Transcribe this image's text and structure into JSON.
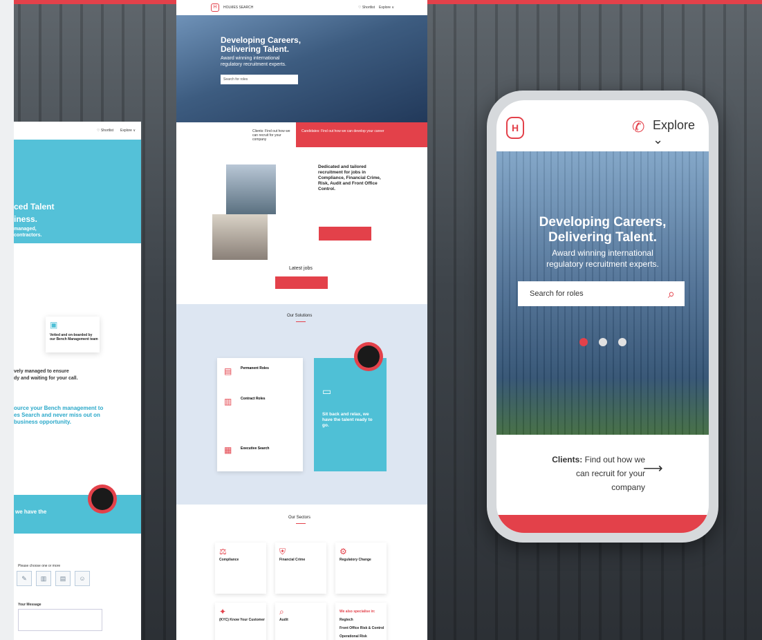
{
  "colors": {
    "accent": "#e3414a",
    "teal": "#4fc0d6",
    "light_blue": "#dde6f2"
  },
  "left_page": {
    "header": {
      "shortlist": "♡ Shortlist",
      "explore": "Explore ∨"
    },
    "hero_line1": "ced Talent",
    "hero_line2": "iness.",
    "hero_line3": "managed,",
    "hero_line4": "contractors.",
    "card_text": "Vetted and on-boarded by our Bench Management team",
    "bench_line1": "vely managed to ensure",
    "bench_line2": "dy and waiting for your call.",
    "blue_line1": "ource your Bench management to",
    "blue_line2": "es Search and never miss out on",
    "blue_line3": "business opportunity.",
    "teal_text": "we have the",
    "choose_label": "Please choose one or more",
    "message_label": "Your Message"
  },
  "center_page": {
    "nav_brand": "HOLMES SEARCH",
    "nav_shortlist": "♡ Shortlist",
    "nav_explore": "Explore ∨",
    "hero_title_1": "Developing Careers,",
    "hero_title_2": "Delivering Talent.",
    "hero_sub_1": "Award winning international",
    "hero_sub_2": "regulatory recruitment experts.",
    "search_placeholder": "Search for roles",
    "cta_clients": "Clients: Find out how we can recruit for your company",
    "cta_candidates": "Candidates: Find out how we can develop your career",
    "intro_1": "Dedicated and tailored",
    "intro_2": "recruitment for jobs in",
    "intro_3": "Compliance, Financial Crime,",
    "intro_4": "Risk, Audit and Front Office",
    "intro_5": "Control.",
    "latest_jobs": "Latest jobs",
    "solutions_title": "Our Solutions",
    "sol_permanent": "Permanent Roles",
    "sol_contract": "Contract Roles",
    "sol_exec": "Executive Search",
    "teal_1": "Sit back and relax, we",
    "teal_2": "have the talent ready to",
    "teal_3": "go.",
    "sectors_title": "Our Sectors",
    "sec_compliance": "Compliance",
    "sec_fincrime": "Financial Crime",
    "sec_regulatory": "Regulatory Change",
    "sec_kyc": "(KYC) Know Your Customer",
    "sec_audit": "Audit",
    "sec_spec": "We also specialise in:",
    "sec_regtech": "Regtech",
    "sec_front": "Front Office Risk & Control",
    "sec_ops": "Operational Risk"
  },
  "phone": {
    "explore": "Explore",
    "hero_title_1": "Developing Careers,",
    "hero_title_2": "Delivering Talent.",
    "hero_sub_1": "Award winning international",
    "hero_sub_2": "regulatory recruitment experts.",
    "search_placeholder": "Search for roles",
    "clients_bold": "Clients:",
    "clients_text_1": "Find out how we",
    "clients_text_2": "can recruit for your",
    "clients_text_3": "company"
  }
}
